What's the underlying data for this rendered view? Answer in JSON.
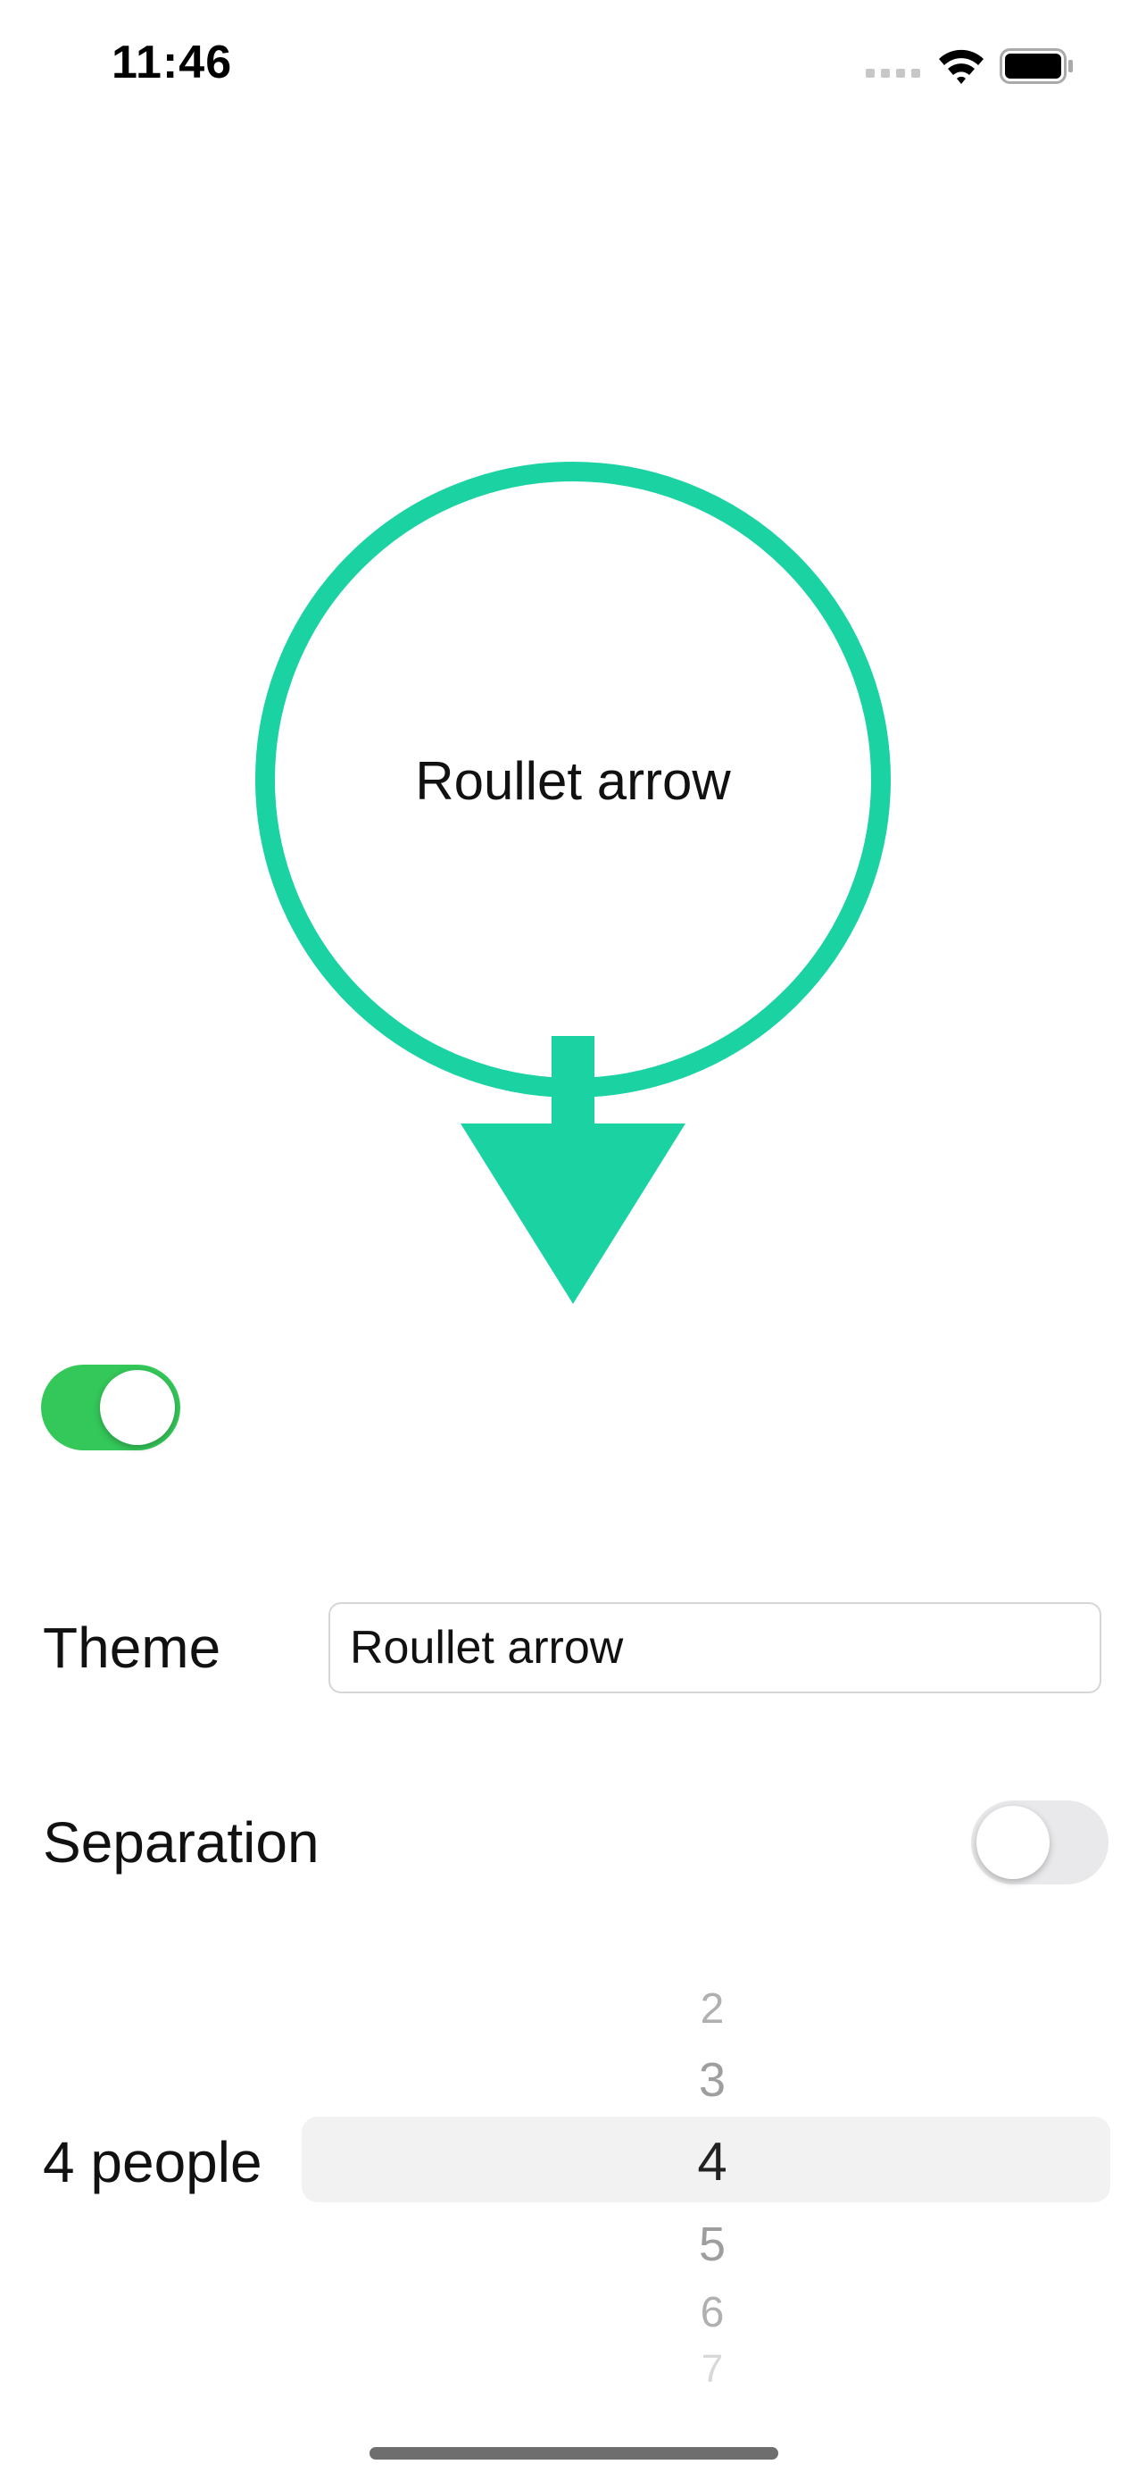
{
  "status_bar": {
    "time": "11:46"
  },
  "roulette": {
    "label": "Roullet arrow",
    "color": "#1bd2a3"
  },
  "main_switch": {
    "on": true,
    "color": "#34c759"
  },
  "theme": {
    "label": "Theme",
    "value": "Roullet arrow"
  },
  "separation": {
    "label": "Separation",
    "on": false
  },
  "people": {
    "label": "4 people",
    "picker_items": [
      "2",
      "3",
      "4",
      "5",
      "6",
      "7"
    ],
    "selected": "4"
  }
}
